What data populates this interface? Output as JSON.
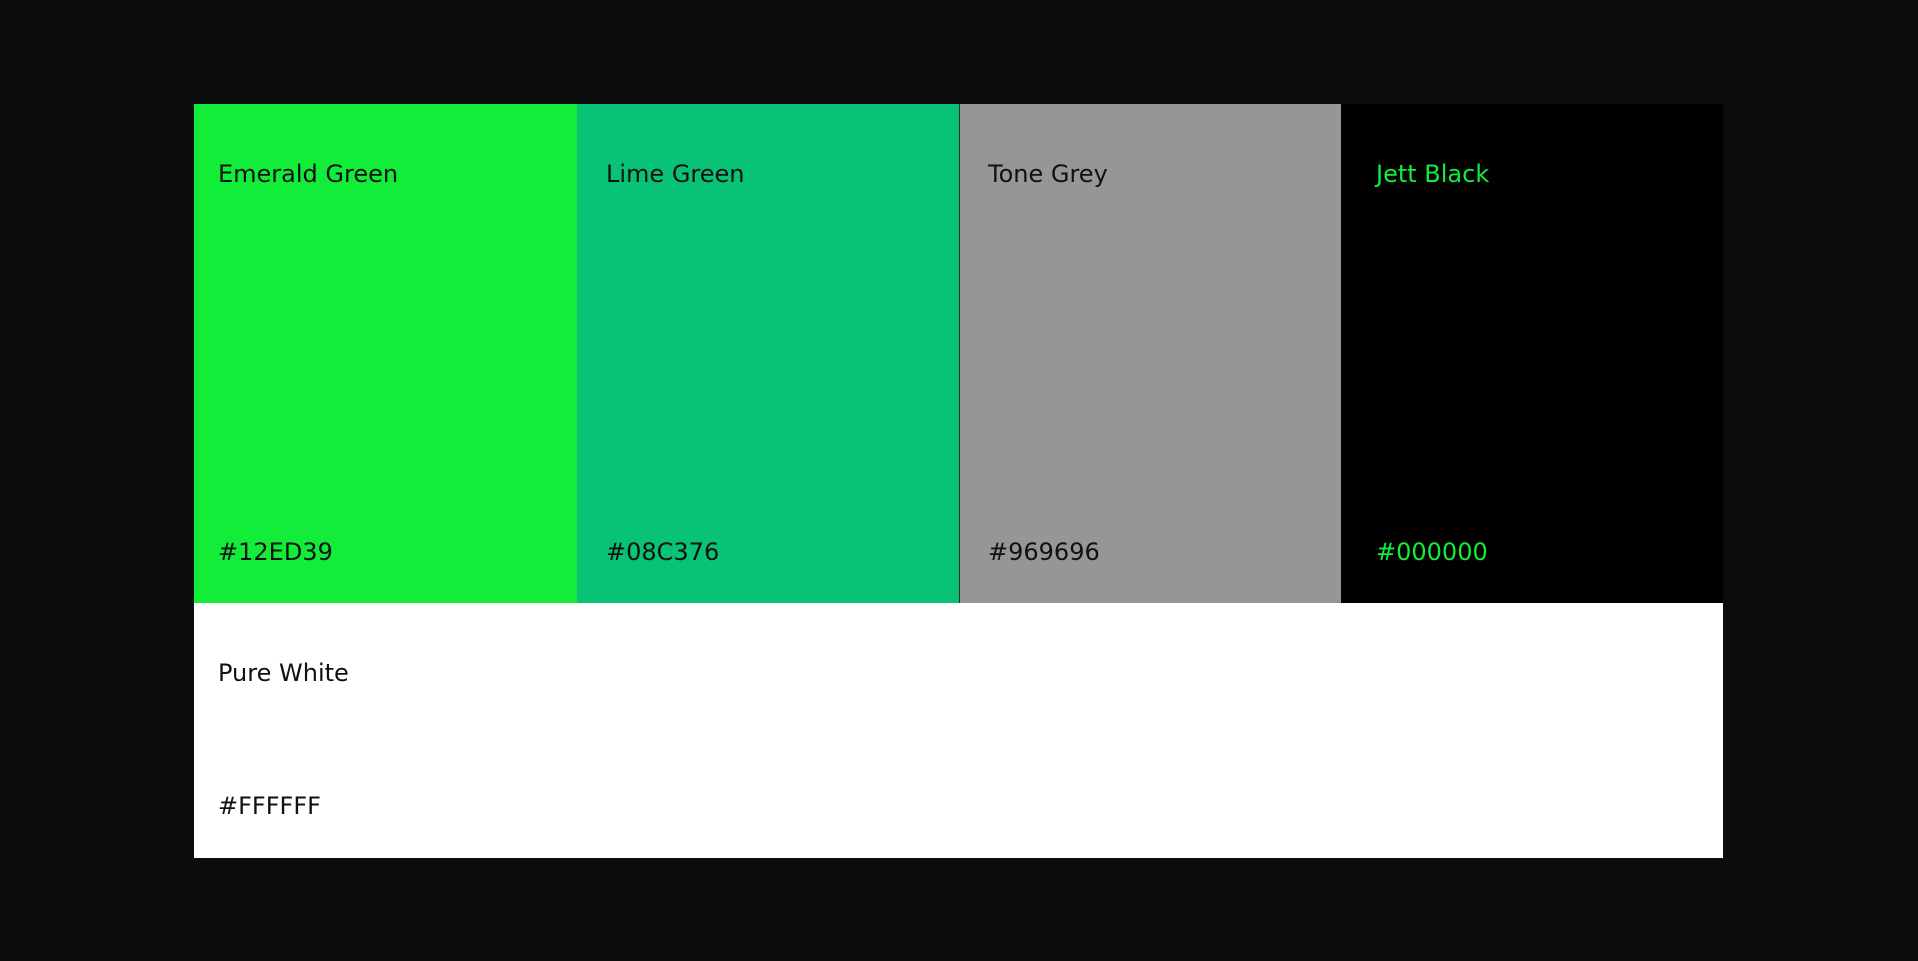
{
  "swatches": [
    {
      "name": "Emerald Green",
      "hex": "#12ED39",
      "background": "#12ED39",
      "text_color": "#111111"
    },
    {
      "name": "Lime Green",
      "hex": "#08C376",
      "background": "#08C376",
      "text_color": "#111111"
    },
    {
      "name": "Tone Grey",
      "hex": "#969696",
      "background": "#969696",
      "text_color": "#111111"
    },
    {
      "name": "Jett Black",
      "hex": "#000000",
      "background": "#000000",
      "text_color": "#12ED39"
    }
  ],
  "white_swatch": {
    "name": "Pure White",
    "hex": "#FFFFFF",
    "background": "#FFFFFF",
    "text_color": "#111111"
  },
  "page_background": "#0C0C0C"
}
